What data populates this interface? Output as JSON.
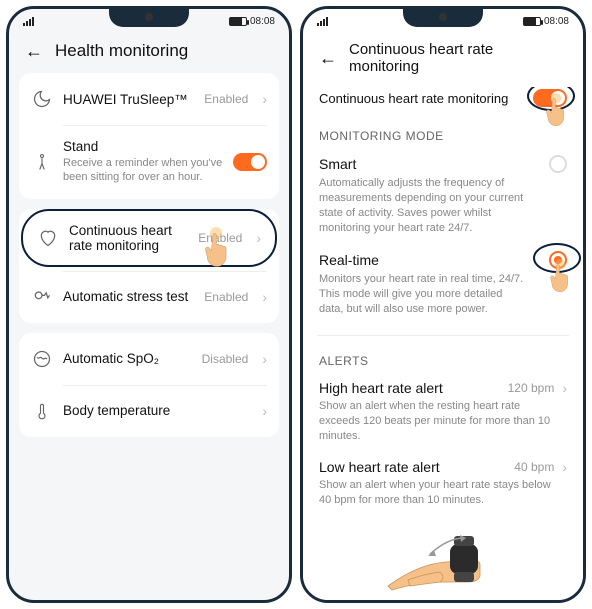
{
  "status": {
    "time": "08:08"
  },
  "screen1": {
    "title": "Health monitoring",
    "items": [
      {
        "icon": "moon",
        "title": "HUAWEI TruSleep™",
        "status": "Enabled"
      },
      {
        "icon": "stand",
        "title": "Stand",
        "sub": "Receive a reminder when you've been sitting for over an hour.",
        "toggle": true
      },
      {
        "icon": "heart",
        "title": "Continuous heart rate monitoring",
        "status": "Enabled"
      },
      {
        "icon": "stress",
        "title": "Automatic stress test",
        "status": "Enabled"
      },
      {
        "icon": "spo2",
        "title": "Automatic SpO₂",
        "status": "Disabled"
      },
      {
        "icon": "temp",
        "title": "Body temperature",
        "status": ""
      }
    ]
  },
  "screen2": {
    "title": "Continuous heart rate monitoring",
    "top_toggle_label": "Continuous heart rate monitoring",
    "sections": {
      "mode_header": "MONITORING MODE",
      "modes": [
        {
          "title": "Smart",
          "desc": "Automatically adjusts the frequency of measurements depending on your current state of activity. Saves power whilst monitoring your heart rate 24/7.",
          "selected": false
        },
        {
          "title": "Real-time",
          "desc": "Monitors your heart rate in real time, 24/7. This mode will give you more detailed data, but will also use more power.",
          "selected": true
        }
      ],
      "alerts_header": "ALERTS",
      "alerts": [
        {
          "title": "High heart rate alert",
          "value": "120 bpm",
          "desc": "Show an alert when the resting heart rate exceeds 120 beats per minute for more than 10 minutes."
        },
        {
          "title": "Low heart rate alert",
          "value": "40 bpm",
          "desc": "Show an alert when your heart rate stays below 40 bpm for more than 10 minutes."
        }
      ]
    }
  }
}
